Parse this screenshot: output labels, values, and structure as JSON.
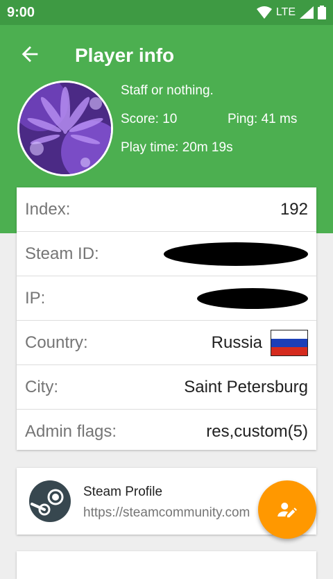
{
  "status_bar": {
    "time": "9:00",
    "network": "LTE"
  },
  "header": {
    "title": "Player info",
    "player_name": "Staff or nothing.",
    "score": "Score: 10",
    "ping": "Ping: 41 ms",
    "play_time": "Play time: 20m 19s"
  },
  "info_rows": [
    {
      "label": "Index:",
      "value": "192"
    },
    {
      "label": "Steam ID:",
      "value": ""
    },
    {
      "label": "IP:",
      "value": ""
    },
    {
      "label": "Country:",
      "value": "Russia"
    },
    {
      "label": "City:",
      "value": "Saint Petersburg"
    },
    {
      "label": "Admin flags:",
      "value": "res,custom(5)"
    }
  ],
  "steam_profile": {
    "title": "Steam Profile",
    "url": "https://steamcommunity.com"
  },
  "icons": {
    "back": "arrow-back-icon",
    "wifi": "wifi-icon",
    "signal": "signal-icon",
    "battery": "battery-icon",
    "steam": "steam-icon",
    "fab": "edit-user-icon"
  },
  "colors": {
    "status_bar": "#3e9a43",
    "header": "#4caf50",
    "fab": "#ff9800",
    "steam_logo": "#37474f"
  }
}
